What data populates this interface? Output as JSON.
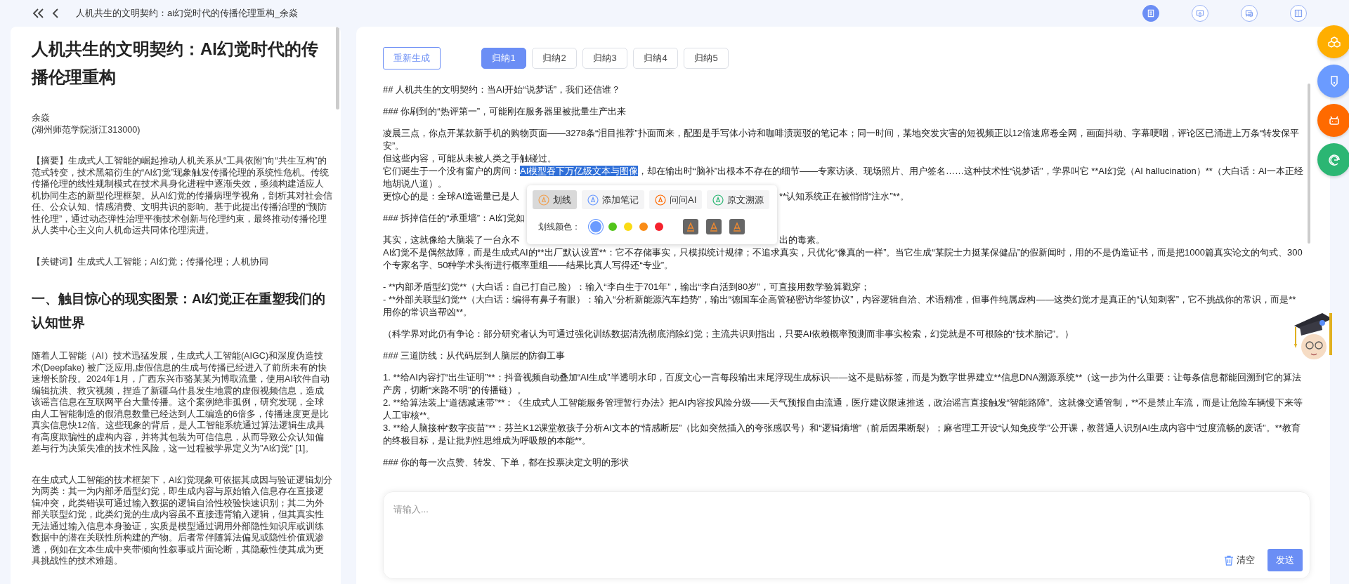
{
  "header": {
    "title": "人机共生的文明契约：ai幻觉时代的传播伦理重构_余焱",
    "toolbar_icons": [
      {
        "selected": true
      },
      {
        "selected": false
      },
      {
        "selected": false
      },
      {
        "selected": false
      }
    ]
  },
  "article": {
    "title": "人机共生的文明契约：AI幻觉时代的传播伦理重构",
    "author": "余焱",
    "affiliation": "(湖州师范学院浙江313000)",
    "abstract": "【摘要】生成式人工智能的崛起推动人机关系从“工具依附”向“共生互构”的范式转变，技术黑箱衍生的“AI幻觉”现象触发传播伦理的系统性危机。传统传播伦理的线性规制模式在技术具身化进程中逐渐失效，亟须构建适应人机协同生态的新型伦理框架。从AI幻觉的传播病理学视角，剖析其对社会信任、公众认知、情感消费、文明共识的影响。基于此提出传播治理的“预防性伦理”，通过动态弹性治理平衡技术创新与伦理约束，最终推动传播伦理从人类中心主义向人机命运共同体伦理演进。",
    "keywords": "【关键词】生成式人工智能；AI幻觉；传播伦理；人机协同",
    "section_heading": "一、触目惊心的现实图景：AI幻觉正在重塑我们的认知世界",
    "paragraphs": [
      "随着人工智能（AI）技术迅猛发展，生成式人工智能(AIGC)和深度伪造技术(Deepfake) 被广泛应用,虚假信息的生成与传播已经进入了前所未有的快速增长阶段。2024年1月，广西东兴市骆某某为博取流量，使用AI软件自动编辑抗洪、救灾视频，捏造了新疆乌什县发生地震的虚假视频信息，造成该谣言信息在互联网平台大量传播。这个案例绝非孤例，研究发现，全球由人工智能制造的假消息数量已经达到人工编造的6倍多，传播速度更是比真实信息快12倍。这些现象的背后，是人工智能系统通过算法逻辑生成具有高度欺骗性的虚构内容，并将其包装为可信信息，从而导致公众认知偏差与行为决策失准的技术性风险，这一过程被学界定义为\"AI幻觉\" [1]。",
      "在生成式人工智能的技术框架下，AI幻觉现象可依据其成因与验证逻辑划分为两类：其一为内部矛盾型幻觉，即生成内容与原始输入信息存在直接逻辑冲突，此类错误可通过输入数据的逻辑自洽性校验快速识别；其二为外部关联型幻觉，此类幻觉的生成内容虽不直接违背输入逻辑，但其真实性无法通过输入信息本身验证，实质是模型通过调用外部隐性知识库或训练数据中的潜在关联性所构建的产物。后者常伴随算法偏见或隐性价值观渗透，例如在文本生成中夹带倾向性叙事或片面论断，其隐蔽性使其成为更具挑战性的技术难题。"
    ]
  },
  "summary": {
    "regenerate_button": "重新生成",
    "tabs": [
      {
        "label": "归纳1",
        "selected": true
      },
      {
        "label": "归纳2",
        "selected": false
      },
      {
        "label": "归纳3",
        "selected": false
      },
      {
        "label": "归纳4",
        "selected": false
      },
      {
        "label": "归纳5",
        "selected": false
      }
    ],
    "blocks": [
      {
        "lines": [
          {
            "kind": "plain",
            "text": "## 人机共生的文明契约：当AI开始“说梦话”，我们还信谁？"
          }
        ]
      },
      {
        "lines": [
          {
            "kind": "plain",
            "text": "### 你刷到的“热评第一”，可能刚在服务器里被批量生产出来"
          }
        ]
      },
      {
        "lines": [
          {
            "kind": "plain",
            "text": "凌晨三点，你点开某款新手机的购物页面——3278条“泪目推荐”扑面而来，配图是手写体小诗和咖啡渍斑驳的笔记本；同一时间，某地突发灾害的短视频正以12倍速席卷全网，画面抖动、字幕哽咽，评论区已涌进上万条“转发保平安”。"
          },
          {
            "kind": "plain",
            "text": "但这些内容，可能从未被人类之手触碰过。"
          },
          {
            "kind": "highlight",
            "before": "它们诞生于一个没有窗户的房间：",
            "highlight": "AI模型吞下万亿级文本与图像",
            "after": "，却在输出时“脑补”出根本不存在的细节——专家访谈、现场照片、用户签名……这种技术性“说梦话”，学界叫它 **AI幻觉（AI hallucination）**（大白话：AI一本正经地胡说八道）。"
          },
          {
            "kind": "split",
            "left": "更惊心的是：全球AI造谣量已是人",
            "right": "**认知系统正在被悄悄“注水”**。"
          }
        ]
      },
      {
        "lines": [
          {
            "kind": "split",
            "left": "### 拆掉信任的“承重墙”：AI幻觉如"
          }
        ]
      },
      {
        "lines": [
          {
            "kind": "split",
            "left": "其实，这就像给大脑装了一台永不",
            "right": "出的毒素。"
          },
          {
            "kind": "plain",
            "text": "AI幻觉不是偶然故障，而是生成式AI的**出厂默认设置**：它不存储事实，只模拟统计规律；不追求真实，只优化“像真的一样”。当它生成“某院士力挺某保健品”的假新闻时，用的不是伪造证书，而是把1000篇真实论文的句式、300个专家名字、50种学术头衔进行概率重组——结果比真人写得还“专业”。"
          }
        ]
      },
      {
        "lines": [
          {
            "kind": "plain",
            "text": "- **内部矛盾型幻觉**（大白话：自己打自己脸）：输入“李白生于701年”，输出“李白活到80岁”，可直接用数学验算戳穿；"
          },
          {
            "kind": "plain",
            "text": "- **外部关联型幻觉**（大白话：编得有鼻子有眼）：输入“分析新能源汽车趋势”，输出“德国车企高管秘密访华签协议”，内容逻辑自洽、术语精准，但事件纯属虚构——这类幻觉才是真正的“认知刺客”，它不挑战你的常识，而是**用你的常识当帮凶**。"
          }
        ]
      },
      {
        "lines": [
          {
            "kind": "plain",
            "text": "（科学界对此仍有争论：部分研究者认为可通过强化训练数据清洗彻底消除幻觉；主流共识则指出，只要AI依赖概率预测而非事实检索，幻觉就是不可根除的“技术胎记”。）"
          }
        ]
      },
      {
        "lines": [
          {
            "kind": "plain",
            "text": "### 三道防线：从代码层到人脑层的防御工事"
          }
        ]
      },
      {
        "lines": [
          {
            "kind": "plain",
            "text": "1. **给AI内容打“出生证明”**：抖音视频自动叠加“AI生成”半透明水印，百度文心一言每段输出末尾浮现生成标识——这不是贴标签，而是为数字世界建立**信息DNA溯源系统**（这一步为什么重要：让每条信息都能回溯到它的算法产房，切断“来路不明”的传播链）。"
          },
          {
            "kind": "plain",
            "text": "2. **给算法装上“道德减速带”**：《生成式人工智能服务管理暂行办法》把AI内容按风险分级——天气预报自由流通，医疗建议限速推送，政治谣言直接触发“智能路障”。这就像交通管制，**不是禁止车流，而是让危险车辆慢下来等人工审核**。"
          },
          {
            "kind": "plain",
            "text": "3. **给人脑接种“数字疫苗”**：芬兰K12课堂教孩子分析AI文本的“情感断层”（比如突然插入的夸张感叹号）和“逻辑熵增”（前后因果断裂）；麻省理工开设“认知免疫学”公开课，教普通人识别AI生成内容中“过度流畅的废话”。**教育的终极目标，是让批判性思维成为呼吸般的本能**。"
          }
        ]
      },
      {
        "lines": [
          {
            "kind": "plain",
            "text": "### 你的每一次点赞、转发、下单，都在投票决定文明的形状"
          }
        ]
      }
    ]
  },
  "popup": {
    "actions": [
      {
        "label": "划线",
        "selected": true
      },
      {
        "label": "添加笔记",
        "selected": false
      },
      {
        "label": "问问AI",
        "selected": false
      },
      {
        "label": "原文溯源",
        "selected": false
      }
    ],
    "color_label": "划线颜色：",
    "colors": [
      {
        "color": "#6b9bff",
        "selected": true
      },
      {
        "color": "#52c41a",
        "selected": false
      },
      {
        "color": "#fadb14",
        "selected": false
      },
      {
        "color": "#fa8c16",
        "selected": false
      },
      {
        "color": "#f5222d",
        "selected": false
      }
    ]
  },
  "input": {
    "placeholder": "请输入...",
    "clear_label": "清空",
    "send_label": "发送"
  },
  "floating_buttons": [
    {
      "color": "#ffae00"
    },
    {
      "color": "#6b9bff"
    },
    {
      "color": "#ff6a00"
    },
    {
      "color": "#2bb673"
    }
  ]
}
